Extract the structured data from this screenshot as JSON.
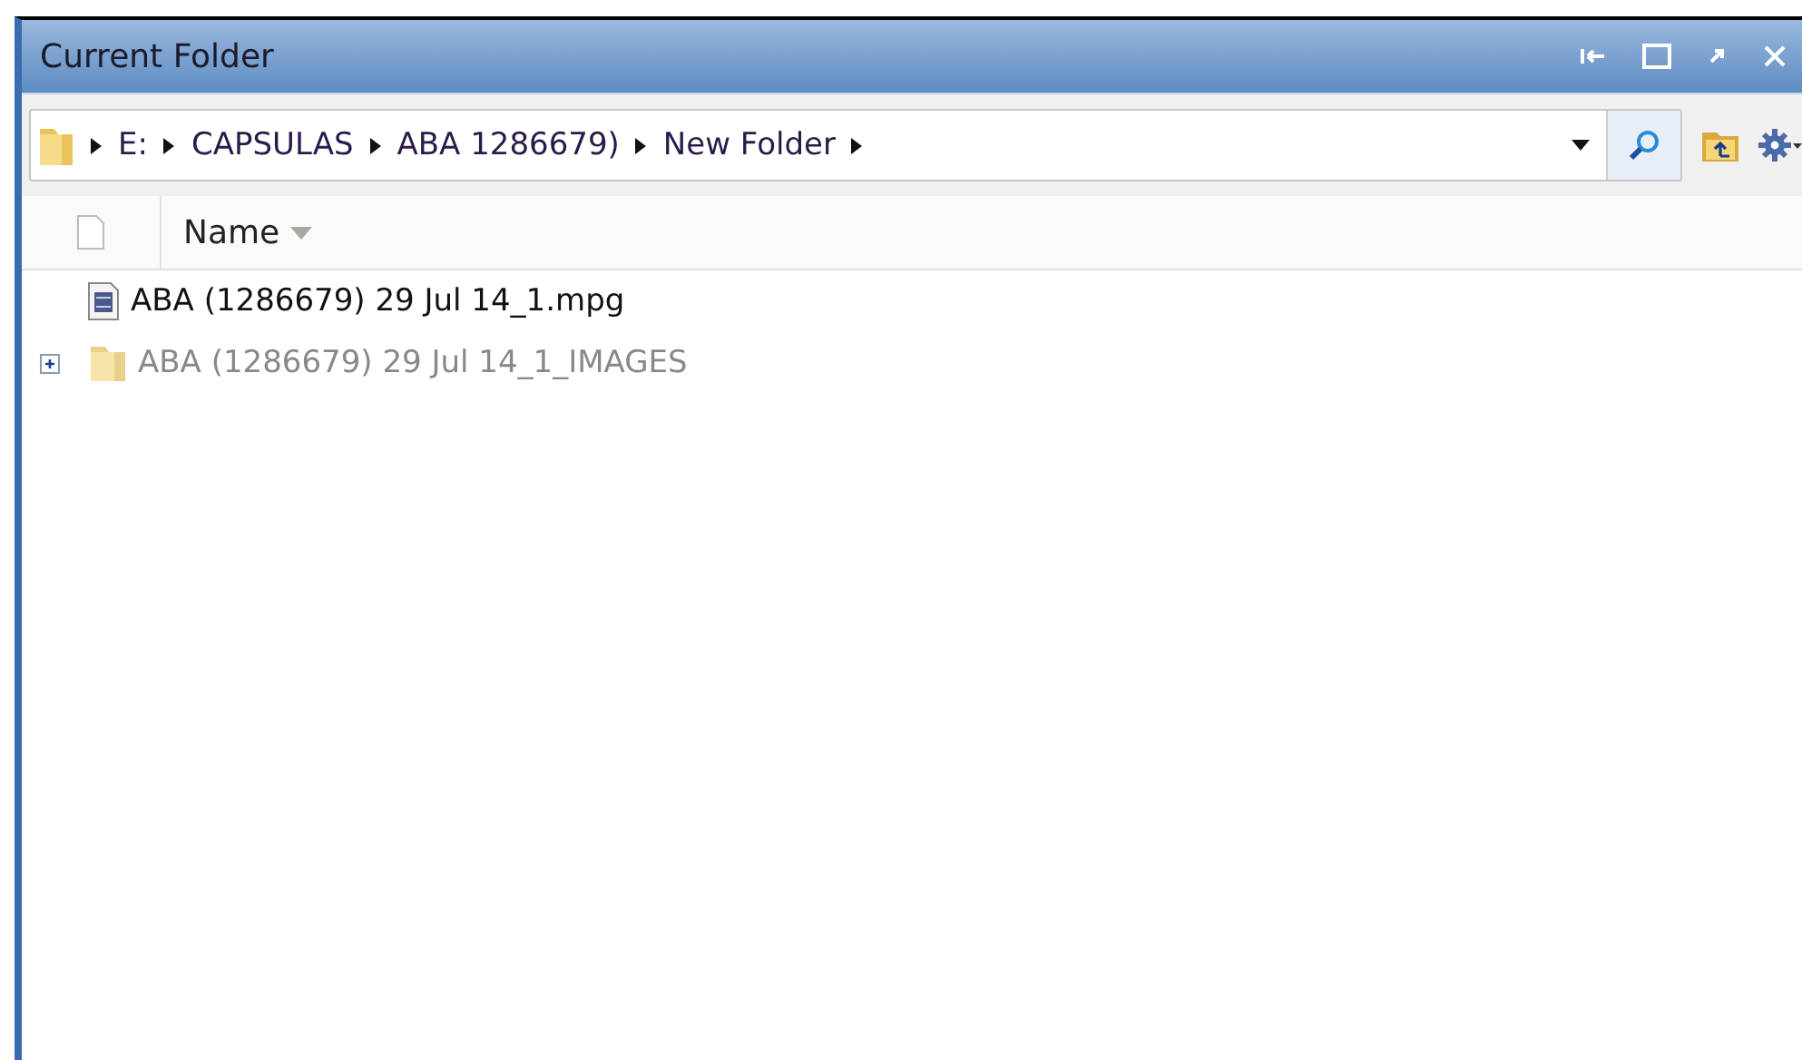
{
  "window": {
    "title": "Current Folder"
  },
  "address_bar": {
    "path": [
      {
        "label": "E:"
      },
      {
        "label": "CAPSULAS"
      },
      {
        "label": "ABA 1286679)"
      },
      {
        "label": "New Folder"
      }
    ]
  },
  "list": {
    "columns": [
      {
        "label": "Name",
        "sorted": true
      }
    ],
    "rows": [
      {
        "kind": "file",
        "name": "ABA (1286679) 29 Jul 14_1.mpg",
        "dimmed": false
      },
      {
        "kind": "folder",
        "name": "ABA (1286679) 29 Jul 14_1_IMAGES",
        "dimmed": true,
        "expanded": false
      }
    ]
  }
}
